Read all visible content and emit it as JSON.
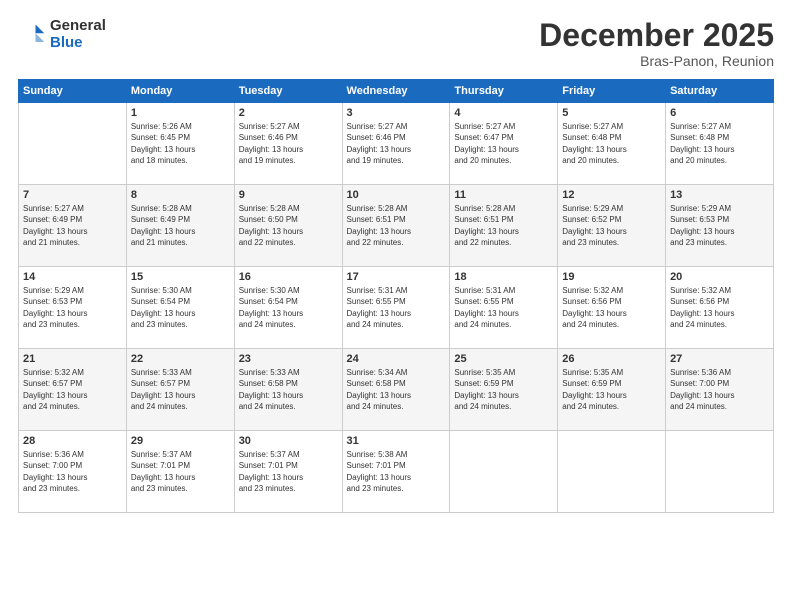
{
  "header": {
    "logo": {
      "line1": "General",
      "line2": "Blue"
    },
    "title": "December 2025",
    "subtitle": "Bras-Panon, Reunion"
  },
  "days_of_week": [
    "Sunday",
    "Monday",
    "Tuesday",
    "Wednesday",
    "Thursday",
    "Friday",
    "Saturday"
  ],
  "weeks": [
    [
      {
        "day": "",
        "info": ""
      },
      {
        "day": "1",
        "info": "Sunrise: 5:26 AM\nSunset: 6:45 PM\nDaylight: 13 hours\nand 18 minutes."
      },
      {
        "day": "2",
        "info": "Sunrise: 5:27 AM\nSunset: 6:46 PM\nDaylight: 13 hours\nand 19 minutes."
      },
      {
        "day": "3",
        "info": "Sunrise: 5:27 AM\nSunset: 6:46 PM\nDaylight: 13 hours\nand 19 minutes."
      },
      {
        "day": "4",
        "info": "Sunrise: 5:27 AM\nSunset: 6:47 PM\nDaylight: 13 hours\nand 20 minutes."
      },
      {
        "day": "5",
        "info": "Sunrise: 5:27 AM\nSunset: 6:48 PM\nDaylight: 13 hours\nand 20 minutes."
      },
      {
        "day": "6",
        "info": "Sunrise: 5:27 AM\nSunset: 6:48 PM\nDaylight: 13 hours\nand 20 minutes."
      }
    ],
    [
      {
        "day": "7",
        "info": "Sunrise: 5:27 AM\nSunset: 6:49 PM\nDaylight: 13 hours\nand 21 minutes."
      },
      {
        "day": "8",
        "info": "Sunrise: 5:28 AM\nSunset: 6:49 PM\nDaylight: 13 hours\nand 21 minutes."
      },
      {
        "day": "9",
        "info": "Sunrise: 5:28 AM\nSunset: 6:50 PM\nDaylight: 13 hours\nand 22 minutes."
      },
      {
        "day": "10",
        "info": "Sunrise: 5:28 AM\nSunset: 6:51 PM\nDaylight: 13 hours\nand 22 minutes."
      },
      {
        "day": "11",
        "info": "Sunrise: 5:28 AM\nSunset: 6:51 PM\nDaylight: 13 hours\nand 22 minutes."
      },
      {
        "day": "12",
        "info": "Sunrise: 5:29 AM\nSunset: 6:52 PM\nDaylight: 13 hours\nand 23 minutes."
      },
      {
        "day": "13",
        "info": "Sunrise: 5:29 AM\nSunset: 6:53 PM\nDaylight: 13 hours\nand 23 minutes."
      }
    ],
    [
      {
        "day": "14",
        "info": "Sunrise: 5:29 AM\nSunset: 6:53 PM\nDaylight: 13 hours\nand 23 minutes."
      },
      {
        "day": "15",
        "info": "Sunrise: 5:30 AM\nSunset: 6:54 PM\nDaylight: 13 hours\nand 23 minutes."
      },
      {
        "day": "16",
        "info": "Sunrise: 5:30 AM\nSunset: 6:54 PM\nDaylight: 13 hours\nand 24 minutes."
      },
      {
        "day": "17",
        "info": "Sunrise: 5:31 AM\nSunset: 6:55 PM\nDaylight: 13 hours\nand 24 minutes."
      },
      {
        "day": "18",
        "info": "Sunrise: 5:31 AM\nSunset: 6:55 PM\nDaylight: 13 hours\nand 24 minutes."
      },
      {
        "day": "19",
        "info": "Sunrise: 5:32 AM\nSunset: 6:56 PM\nDaylight: 13 hours\nand 24 minutes."
      },
      {
        "day": "20",
        "info": "Sunrise: 5:32 AM\nSunset: 6:56 PM\nDaylight: 13 hours\nand 24 minutes."
      }
    ],
    [
      {
        "day": "21",
        "info": "Sunrise: 5:32 AM\nSunset: 6:57 PM\nDaylight: 13 hours\nand 24 minutes."
      },
      {
        "day": "22",
        "info": "Sunrise: 5:33 AM\nSunset: 6:57 PM\nDaylight: 13 hours\nand 24 minutes."
      },
      {
        "day": "23",
        "info": "Sunrise: 5:33 AM\nSunset: 6:58 PM\nDaylight: 13 hours\nand 24 minutes."
      },
      {
        "day": "24",
        "info": "Sunrise: 5:34 AM\nSunset: 6:58 PM\nDaylight: 13 hours\nand 24 minutes."
      },
      {
        "day": "25",
        "info": "Sunrise: 5:35 AM\nSunset: 6:59 PM\nDaylight: 13 hours\nand 24 minutes."
      },
      {
        "day": "26",
        "info": "Sunrise: 5:35 AM\nSunset: 6:59 PM\nDaylight: 13 hours\nand 24 minutes."
      },
      {
        "day": "27",
        "info": "Sunrise: 5:36 AM\nSunset: 7:00 PM\nDaylight: 13 hours\nand 24 minutes."
      }
    ],
    [
      {
        "day": "28",
        "info": "Sunrise: 5:36 AM\nSunset: 7:00 PM\nDaylight: 13 hours\nand 23 minutes."
      },
      {
        "day": "29",
        "info": "Sunrise: 5:37 AM\nSunset: 7:01 PM\nDaylight: 13 hours\nand 23 minutes."
      },
      {
        "day": "30",
        "info": "Sunrise: 5:37 AM\nSunset: 7:01 PM\nDaylight: 13 hours\nand 23 minutes."
      },
      {
        "day": "31",
        "info": "Sunrise: 5:38 AM\nSunset: 7:01 PM\nDaylight: 13 hours\nand 23 minutes."
      },
      {
        "day": "",
        "info": ""
      },
      {
        "day": "",
        "info": ""
      },
      {
        "day": "",
        "info": ""
      }
    ]
  ]
}
